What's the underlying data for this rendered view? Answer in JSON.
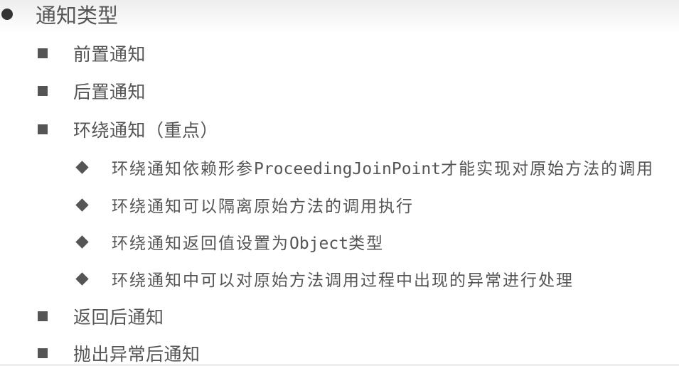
{
  "title": "通知类型",
  "items": [
    {
      "label": "前置通知"
    },
    {
      "label": "后置通知"
    },
    {
      "label": "环绕通知（重点）"
    },
    {
      "label": "返回后通知"
    },
    {
      "label": "抛出异常后通知"
    }
  ],
  "sub_items": [
    {
      "pre": "环绕通知依赖形参",
      "code": "ProceedingJoinPoint",
      "post": "才能实现对原始方法的调用"
    },
    {
      "pre": "环绕通知可以隔离原始方法的调用执行"
    },
    {
      "pre": "环绕通知返回值设置为",
      "code": "Object",
      "post": "类型"
    },
    {
      "pre": "环绕通知中可以对原始方法调用过程中出现的异常进行处理"
    }
  ]
}
